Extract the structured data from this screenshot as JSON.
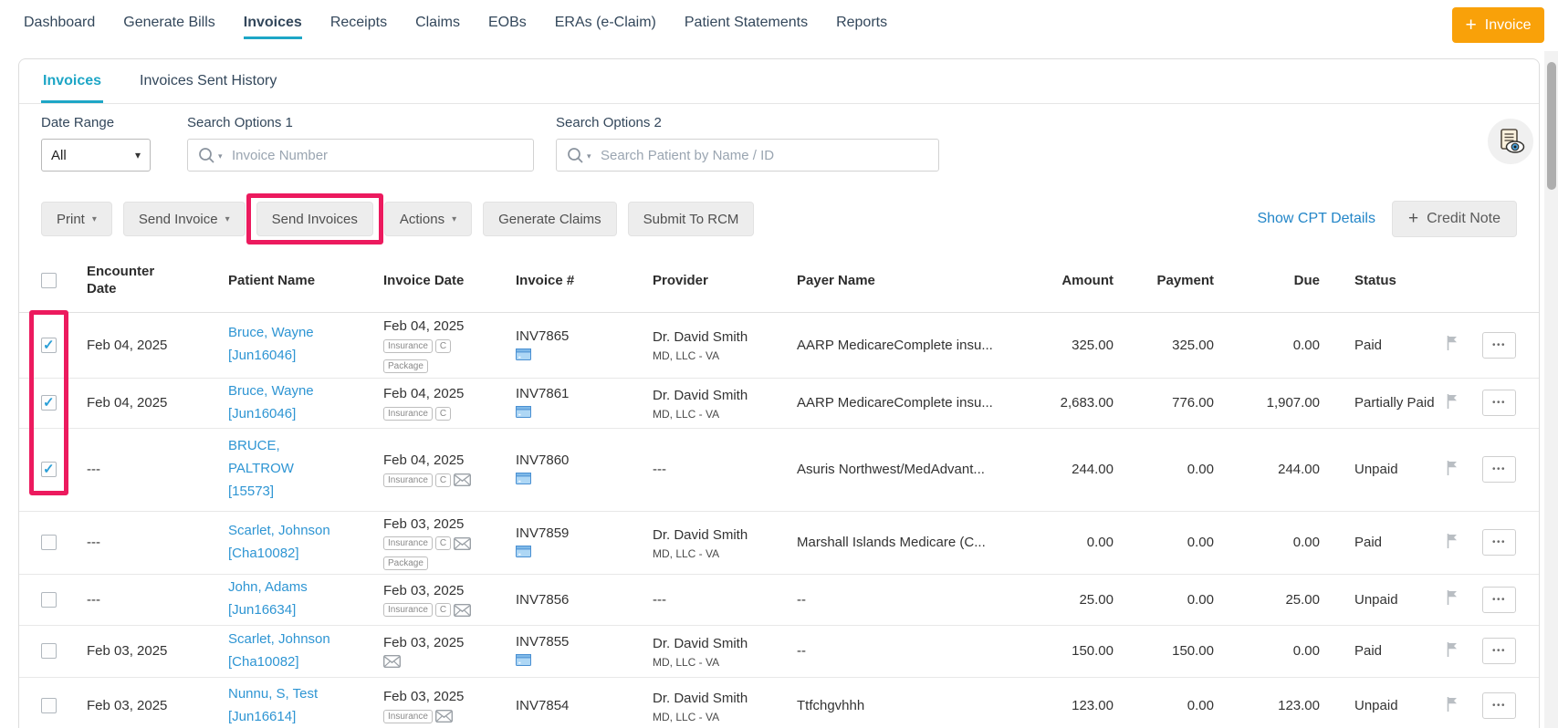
{
  "colors": {
    "teal": "#1ea6c6",
    "orange": "#f9a109",
    "link_blue": "#2386c8",
    "patient_link_blue": "#2e95d3",
    "annotation_pink": "#ec1a5e"
  },
  "icons": {
    "plus": "+",
    "caret_down": "▾",
    "check": "✓",
    "ellipsis": "•••"
  },
  "nav": {
    "items": [
      "Dashboard",
      "Generate Bills",
      "Invoices",
      "Receipts",
      "Claims",
      "EOBs",
      "ERAs (e-Claim)",
      "Patient Statements",
      "Reports"
    ],
    "active": "Invoices",
    "invoice_button_label": "Invoice"
  },
  "tabs": {
    "invoices": "Invoices",
    "sent_history": "Invoices Sent History"
  },
  "filters": {
    "date_range_label": "Date Range",
    "date_range_value": "All",
    "search1_label": "Search Options 1",
    "search1_placeholder": "Invoice Number",
    "search2_label": "Search Options 2",
    "search2_placeholder": "Search Patient by Name / ID"
  },
  "toolbar": {
    "print": "Print",
    "send_invoice": "Send Invoice",
    "send_invoices": "Send Invoices",
    "actions": "Actions",
    "generate_claims": "Generate Claims",
    "submit_to_rcm": "Submit To RCM",
    "show_cpt_details": "Show CPT Details",
    "credit_note": "Credit Note"
  },
  "badge_labels": {
    "insurance": "Insurance",
    "c": "C",
    "package": "Package"
  },
  "table": {
    "headers": {
      "encounter_date": "Encounter Date",
      "patient_name": "Patient Name",
      "invoice_date": "Invoice Date",
      "invoice_no": "Invoice #",
      "provider": "Provider",
      "payer_name": "Payer Name",
      "amount": "Amount",
      "payment": "Payment",
      "due": "Due",
      "status": "Status"
    },
    "rows": [
      {
        "encounter": "Feb 04, 2025",
        "patient": "Bruce, Wayne",
        "patient_id": "[Jun16046]",
        "invoice_date": "Feb 04, 2025",
        "invoice_no": "INV7865",
        "provider": "Dr. David Smith",
        "provider_sub": "MD, LLC - VA",
        "payer": "AARP MedicareComplete insu...",
        "amount": "325.00",
        "payment": "325.00",
        "due": "0.00",
        "status": "Paid"
      },
      {
        "encounter": "Feb 04, 2025",
        "patient": "Bruce, Wayne",
        "patient_id": "[Jun16046]",
        "invoice_date": "Feb 04, 2025",
        "invoice_no": "INV7861",
        "provider": "Dr. David Smith",
        "provider_sub": "MD, LLC - VA",
        "payer": "AARP MedicareComplete insu...",
        "amount": "2,683.00",
        "payment": "776.00",
        "due": "1,907.00",
        "status": "Partially Paid"
      },
      {
        "encounter": "---",
        "patient": "BRUCE, PALTROW",
        "patient_id": "[15573]",
        "invoice_date": "Feb 04, 2025",
        "invoice_no": "INV7860",
        "provider": "---",
        "provider_sub": "",
        "payer": "Asuris Northwest/MedAdvant...",
        "amount": "244.00",
        "payment": "0.00",
        "due": "244.00",
        "status": "Unpaid"
      },
      {
        "encounter": "---",
        "patient": "Scarlet, Johnson",
        "patient_id": "[Cha10082]",
        "invoice_date": "Feb 03, 2025",
        "invoice_no": "INV7859",
        "provider": "Dr. David Smith",
        "provider_sub": "MD, LLC - VA",
        "payer": "Marshall Islands Medicare (C...",
        "amount": "0.00",
        "payment": "0.00",
        "due": "0.00",
        "status": "Paid"
      },
      {
        "encounter": "---",
        "patient": "John, Adams",
        "patient_id": "[Jun16634]",
        "invoice_date": "Feb 03, 2025",
        "invoice_no": "INV7856",
        "provider": "---",
        "provider_sub": "",
        "payer": "--",
        "amount": "25.00",
        "payment": "0.00",
        "due": "25.00",
        "status": "Unpaid"
      },
      {
        "encounter": "Feb 03, 2025",
        "patient": "Scarlet, Johnson",
        "patient_id": "[Cha10082]",
        "invoice_date": "Feb 03, 2025",
        "invoice_no": "INV7855",
        "provider": "Dr. David Smith",
        "provider_sub": "MD, LLC - VA",
        "payer": "--",
        "amount": "150.00",
        "payment": "150.00",
        "due": "0.00",
        "status": "Paid"
      },
      {
        "encounter": "Feb 03, 2025",
        "patient": "Nunnu, S, Test",
        "patient_id": "[Jun16614]",
        "invoice_date": "Feb 03, 2025",
        "invoice_no": "INV7854",
        "provider": "Dr. David Smith",
        "provider_sub": "MD, LLC - VA",
        "payer": "Ttfchgvhhh",
        "amount": "123.00",
        "payment": "0.00",
        "due": "123.00",
        "status": "Unpaid"
      }
    ]
  }
}
